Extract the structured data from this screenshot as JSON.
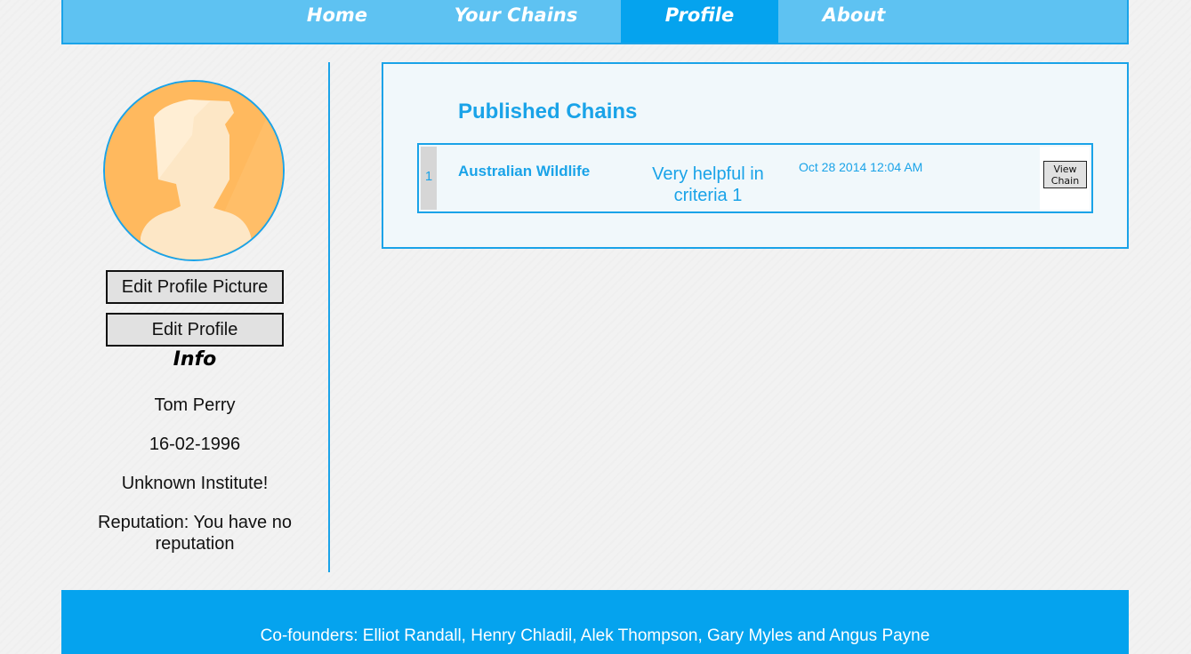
{
  "nav": {
    "items": [
      {
        "label": "Home",
        "active": false
      },
      {
        "label": "Your Chains",
        "active": false
      },
      {
        "label": "Profile",
        "active": true
      },
      {
        "label": "About",
        "active": false
      }
    ]
  },
  "sidebar": {
    "edit_picture_label": "Edit Profile Picture",
    "edit_profile_label": "Edit Profile",
    "info_heading": "Info",
    "name": "Tom Perry",
    "dob": "16-02-1996",
    "institute": "Unknown Institute!",
    "reputation": "Reputation: You have no reputation"
  },
  "published": {
    "title": "Published Chains",
    "rows": [
      {
        "index": "1",
        "name": "Australian Wildlife",
        "description": "Very helpful in criteria 1",
        "date": "Oct 28 2014 12:04 AM",
        "action_label": "View Chain"
      }
    ]
  },
  "footer": {
    "text": "Co-founders: Elliot Randall, Henry Chladil, Alek Thompson, Gary Myles and Angus Payne"
  },
  "colors": {
    "accent": "#1aa3e8",
    "nav_bg": "#5ec2f2",
    "nav_active": "#05a3ee",
    "footer_bg": "#05a3ee",
    "avatar_bg": "#ffb95e"
  },
  "icons": {
    "avatar": "person-silhouette-icon"
  }
}
